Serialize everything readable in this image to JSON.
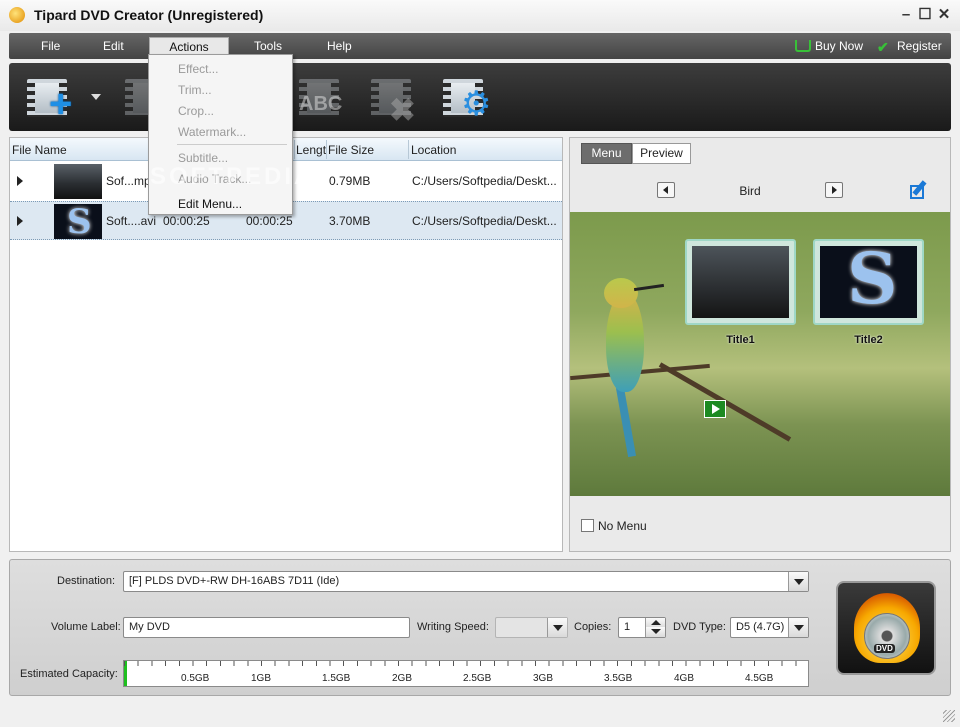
{
  "window": {
    "title": "Tipard DVD Creator (Unregistered)"
  },
  "menubar": {
    "items": [
      "File",
      "Edit",
      "Actions",
      "Tools",
      "Help"
    ],
    "buy_now": "Buy Now",
    "register": "Register"
  },
  "actions_menu": {
    "items": [
      {
        "label": "Effect...",
        "enabled": false
      },
      {
        "label": "Trim...",
        "enabled": false
      },
      {
        "label": "Crop...",
        "enabled": false
      },
      {
        "label": "Watermark...",
        "enabled": false
      },
      {
        "label": "Subtitle...",
        "enabled": false
      },
      {
        "label": "Audio Track...",
        "enabled": false
      },
      {
        "label": "Edit Menu...",
        "enabled": true
      }
    ]
  },
  "toolbar": {
    "icons": [
      "add-file-icon",
      "edit-video-icon",
      "subtitle-icon",
      "delete-icon",
      "settings-icon"
    ],
    "subtitle_text": "ABC"
  },
  "file_list": {
    "headers": [
      "File Name",
      "Lengt",
      "File Size",
      "Location"
    ],
    "rows": [
      {
        "name": "Sof...mpg",
        "duration": "",
        "length": "",
        "size": "0.79MB",
        "location": "C:/Users/Softpedia/Deskt..."
      },
      {
        "name": "Soft....avi",
        "duration": "00:00:25",
        "length": "00:00:25",
        "size": "3.70MB",
        "location": "C:/Users/Softpedia/Deskt..."
      }
    ]
  },
  "watermark": "SOFTPEDIA",
  "preview": {
    "tabs": [
      "Menu",
      "Preview"
    ],
    "theme_name": "Bird",
    "titles": [
      "Title1",
      "Title2"
    ],
    "no_menu_label": "No Menu"
  },
  "output": {
    "destination_label": "Destination:",
    "destination_value": "[F] PLDS DVD+-RW DH-16ABS 7D11 (Ide)",
    "volume_label": "Volume Label:",
    "volume_value": "My DVD",
    "writing_speed_label": "Writing Speed:",
    "copies_label": "Copies:",
    "copies_value": "1",
    "dvd_type_label": "DVD Type:",
    "dvd_type_value": "D5 (4.7G)",
    "capacity_label": "Estimated Capacity:",
    "capacity_ticks": [
      "0.5GB",
      "1GB",
      "1.5GB",
      "2GB",
      "2.5GB",
      "3GB",
      "3.5GB",
      "4GB",
      "4.5GB"
    ],
    "capacity_used_fraction": 0.005,
    "burn_label": "DVD"
  }
}
